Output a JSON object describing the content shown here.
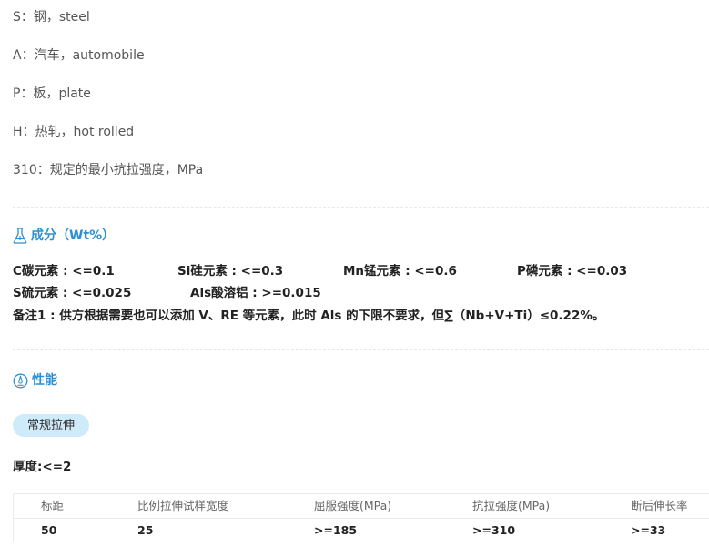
{
  "abbreviations": [
    "S：钢，steel",
    "A：汽车，automobile",
    "P：板，plate",
    "H：热轧，hot rolled",
    "310：规定的最小抗拉强度，MPa"
  ],
  "composition": {
    "title": "成分（Wt%）",
    "row1": [
      "C碳元素 : <=0.1",
      "Si硅元素 : <=0.3",
      "Mn锰元素 : <=0.6",
      "P磷元素 : <=0.03"
    ],
    "row2": [
      "S硫元素 : <=0.025",
      "Als酸溶铝 : >=0.015"
    ],
    "note": "备注1 : 供方根据需要也可以添加 V、RE 等元素，此时 Als 的下限不要求，但∑（Nb+V+Ti）≤0.22%。"
  },
  "performance": {
    "title": "性能",
    "tab_label": "常规拉伸",
    "thickness": "厚度:<=2",
    "table": {
      "headers": [
        "标距",
        "比例拉伸试样宽度",
        "屈服强度(MPa)",
        "抗拉强度(MPa)",
        "断后伸长率"
      ],
      "rows": [
        [
          "50",
          "25",
          ">=185",
          ">=310",
          ">=33"
        ]
      ]
    }
  },
  "colors": {
    "accent": "#2a8fd6",
    "pill": "#cfeaf9",
    "divider": "#e4e8ec"
  },
  "icons": {
    "composition": "flask-icon",
    "performance": "gauge-icon"
  }
}
